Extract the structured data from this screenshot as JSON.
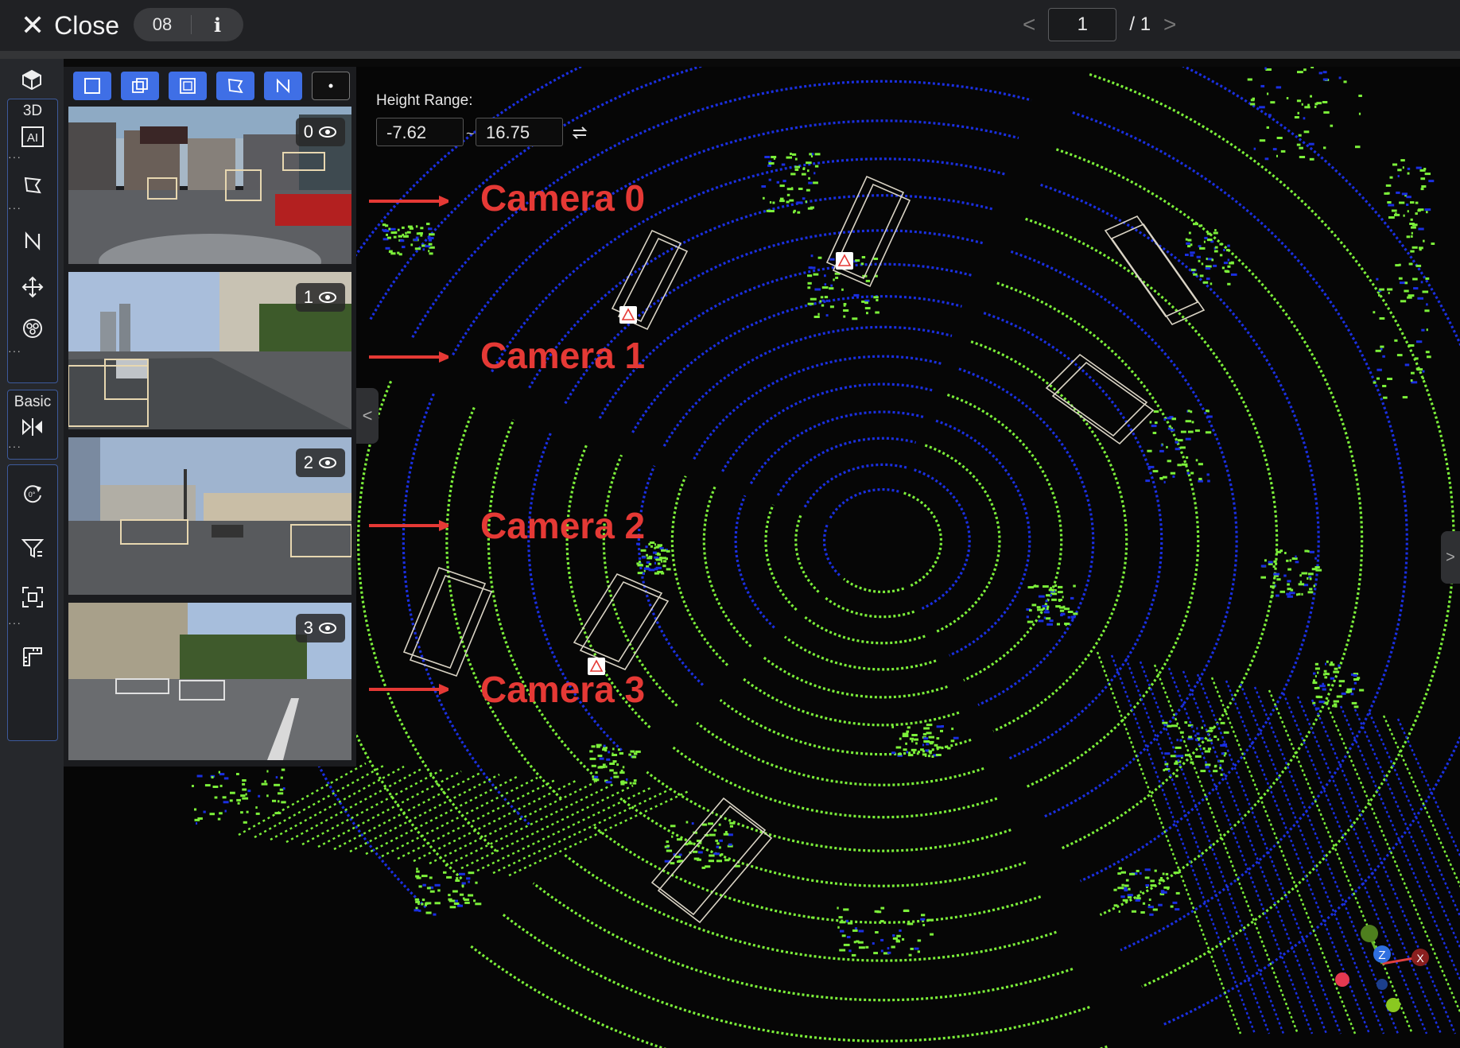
{
  "header": {
    "close_icon": "close-x-icon",
    "close_label": "Close",
    "frame_number": "08",
    "info_icon": "info-icon",
    "info_glyph": "i",
    "page_current": "1",
    "page_total": "/ 1"
  },
  "toolbar": {
    "section_3d": "3D",
    "section_basic": "Basic",
    "tools": [
      "cube-icon",
      "ai-icon",
      "polygon-icon",
      "polyline-icon",
      "move-icon",
      "model-icon",
      "mirror-icon",
      "rotate-icon",
      "filter-icon",
      "focus-icon",
      "ruler-icon"
    ]
  },
  "projection_buttons": [
    "rect-box-icon",
    "cube-box-icon",
    "cuboid-icon",
    "polygon-icon",
    "polyline-icon",
    "point-icon"
  ],
  "cameras": [
    {
      "id": "0"
    },
    {
      "id": "1"
    },
    {
      "id": "2"
    },
    {
      "id": "3"
    }
  ],
  "height_range": {
    "label": "Height Range:",
    "min": "-7.62",
    "separator": "~",
    "max": "16.75"
  },
  "annotations": [
    "Camera 0",
    "Camera 1",
    "Camera 2",
    "Camera 3"
  ],
  "colors": {
    "accent": "#3f6fe6",
    "annotation": "#e53935",
    "point_green": "#7cf03a",
    "point_blue": "#1a2fe0"
  }
}
